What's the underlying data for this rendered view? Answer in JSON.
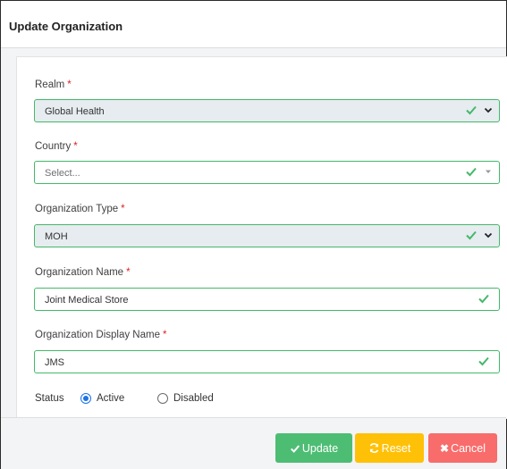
{
  "modal": {
    "title": "Update Organization"
  },
  "form": {
    "realm": {
      "label": "Realm",
      "required": "*",
      "value": "Global Health"
    },
    "country": {
      "label": "Country",
      "required": "*",
      "placeholder": "Select..."
    },
    "org_type": {
      "label": "Organization Type",
      "required": "*",
      "value": "MOH"
    },
    "org_name": {
      "label": "Organization Name",
      "required": "*",
      "value": "Joint Medical Store"
    },
    "org_display_name": {
      "label": "Organization Display Name",
      "required": "*",
      "value": "JMS"
    },
    "status": {
      "label": "Status",
      "options": [
        {
          "label": "Active",
          "selected": true
        },
        {
          "label": "Disabled",
          "selected": false
        }
      ]
    }
  },
  "footer": {
    "update_label": "Update",
    "reset_label": "Reset",
    "cancel_label": "Cancel"
  },
  "colors": {
    "valid_green": "#44b86a",
    "required_red": "#e02020",
    "update_btn": "#4dbd74",
    "reset_btn": "#ffc107",
    "cancel_btn": "#f86c6b",
    "radio_blue": "#1a73e8"
  },
  "icons": [
    "check-icon",
    "chevron-down-icon",
    "caret-down-icon",
    "refresh-icon",
    "close-icon"
  ]
}
